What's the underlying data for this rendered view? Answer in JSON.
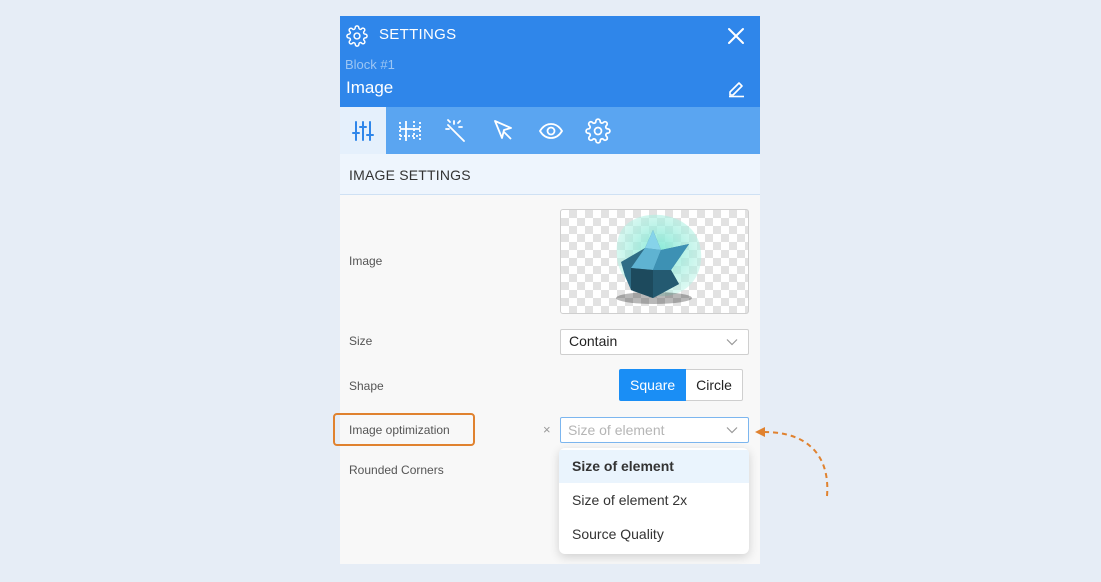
{
  "header": {
    "title": "SETTINGS",
    "block_label": "Block #1",
    "block_name": "Image"
  },
  "toolbar": {
    "tools": [
      "sliders-icon",
      "grid-icon",
      "magic-wand-icon",
      "cursor-icon",
      "eye-icon",
      "gear-icon"
    ],
    "active_index": 0
  },
  "section": {
    "title": "IMAGE SETTINGS"
  },
  "fields": {
    "image_label": "Image",
    "size_label": "Size",
    "size_value": "Contain",
    "shape_label": "Shape",
    "shape_options": [
      "Square",
      "Circle"
    ],
    "shape_selected": "Square",
    "optimization_label": "Image optimization",
    "optimization_clear": "×",
    "optimization_placeholder": "Size of element",
    "rounded_label": "Rounded Corners"
  },
  "dropdown": {
    "options": [
      "Size of element",
      "Size of element 2x",
      "Source Quality"
    ],
    "highlighted": "Size of element"
  },
  "colors": {
    "header_bg": "#2f86ea",
    "toolbar_bg": "#5aa5f1",
    "accent": "#1a8ef5",
    "annotation": "#e0822f"
  }
}
